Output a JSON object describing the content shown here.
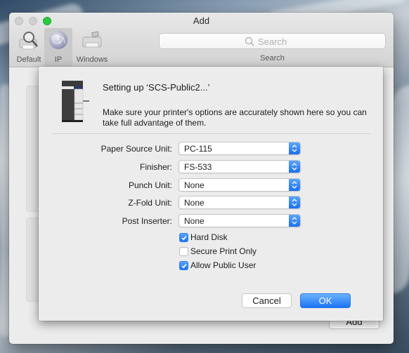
{
  "window": {
    "title": "Add",
    "toolbar": {
      "items": [
        {
          "label": "Default",
          "icon": "default-printer-icon",
          "selected": false
        },
        {
          "label": "IP",
          "icon": "ip-globe-icon",
          "selected": true
        },
        {
          "label": "Windows",
          "icon": "windows-printer-icon",
          "selected": false
        }
      ],
      "search": {
        "placeholder": "Search",
        "label": "Search"
      }
    },
    "add_button": "Add"
  },
  "sheet": {
    "title": "Setting up ‘SCS-Public2...’",
    "description": "Make sure your printer's options are accurately shown here so you can take full advantage of them.",
    "options": [
      {
        "label": "Paper Source Unit:",
        "value": "PC-115"
      },
      {
        "label": "Finisher:",
        "value": "FS-533"
      },
      {
        "label": "Punch Unit:",
        "value": "None"
      },
      {
        "label": "Z-Fold Unit:",
        "value": "None"
      },
      {
        "label": "Post Inserter:",
        "value": "None"
      }
    ],
    "checkboxes": [
      {
        "label": "Hard Disk",
        "checked": true
      },
      {
        "label": "Secure Print Only",
        "checked": false
      },
      {
        "label": "Allow Public User",
        "checked": true
      }
    ],
    "cancel_label": "Cancel",
    "ok_label": "OK"
  },
  "colors": {
    "accent": "#1b73f5",
    "zoom_button": "#2bc840"
  }
}
